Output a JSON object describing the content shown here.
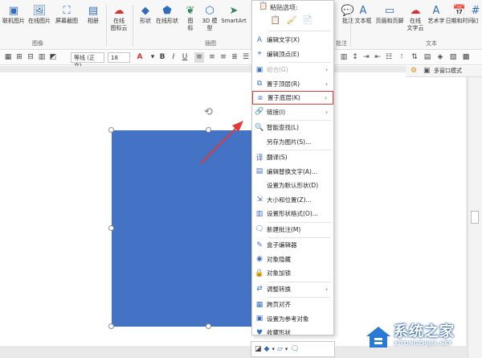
{
  "ribbon": {
    "buttons": [
      {
        "label": "联机图片",
        "icon": "online-picture-icon"
      },
      {
        "label": "在线图片",
        "icon": "online-image-icon"
      },
      {
        "label": "屏幕截图",
        "icon": "screenshot-icon"
      },
      {
        "label": "相册",
        "icon": "album-icon"
      },
      {
        "label": "在线\n图标云",
        "icon": "icon-cloud-icon"
      },
      {
        "label": "形状",
        "icon": "shape-icon"
      },
      {
        "label": "在线形状",
        "icon": "online-shape-icon"
      },
      {
        "label": "图\n标",
        "icon": "icons-icon"
      },
      {
        "label": "3D 模\n型",
        "icon": "3d-model-icon"
      },
      {
        "label": "SmartArt",
        "icon": "smartart-icon"
      },
      {
        "label": "批注",
        "icon": "comment-icon"
      },
      {
        "label": "文本框",
        "icon": "textbox-icon"
      },
      {
        "label": "页眉和页脚",
        "icon": "header-footer-icon"
      },
      {
        "label": "在线\n文字云",
        "icon": "word-cloud-icon"
      },
      {
        "label": "艺术字",
        "icon": "wordart-icon"
      },
      {
        "label": "日期和时间",
        "icon": "date-time-icon"
      },
      {
        "label": "幻",
        "icon": "slide-number-icon"
      }
    ],
    "groups": {
      "image": "图像",
      "illustration": "插图",
      "comment": "批注",
      "text": "文本"
    }
  },
  "format_bar": {
    "font": "等线 (正文)",
    "size": "18"
  },
  "side_panel": {
    "label": "多窗口模式"
  },
  "context_menu": {
    "paste_title": "粘贴选项:",
    "items": [
      {
        "label": "编辑文字(X)",
        "icon": "edit-text-icon",
        "arrow": false,
        "disabled": false
      },
      {
        "label": "编辑顶点(E)",
        "icon": "edit-points-icon",
        "arrow": false,
        "disabled": false
      },
      {
        "label": "组合(G)",
        "icon": "group-icon",
        "arrow": true,
        "disabled": true
      },
      {
        "label": "置于顶层(R)",
        "icon": "bring-to-front-icon",
        "arrow": true,
        "disabled": false
      },
      {
        "label": "置于底层(K)",
        "icon": "send-to-back-icon",
        "arrow": true,
        "disabled": false,
        "highlight": true
      },
      {
        "label": "链接(I)",
        "icon": "link-icon",
        "arrow": true,
        "disabled": false
      },
      {
        "label": "智能查找(L)",
        "icon": "smart-lookup-icon",
        "arrow": false,
        "disabled": false
      },
      {
        "label": "另存为图片(S)...",
        "icon": "save-as-picture-icon",
        "arrow": false,
        "disabled": false
      },
      {
        "label": "翻译(S)",
        "icon": "translate-icon",
        "arrow": false,
        "disabled": false
      },
      {
        "label": "编辑替换文字(A)...",
        "icon": "alt-text-icon",
        "arrow": false,
        "disabled": false
      },
      {
        "label": "设置为默认形状(D)",
        "icon": "default-shape-icon",
        "arrow": false,
        "disabled": false
      },
      {
        "label": "大小和位置(Z)...",
        "icon": "size-position-icon",
        "arrow": false,
        "disabled": false
      },
      {
        "label": "设置形状格式(O)...",
        "icon": "format-shape-icon",
        "arrow": false,
        "disabled": false
      },
      {
        "label": "新建批注(M)",
        "icon": "new-comment-icon",
        "arrow": false,
        "disabled": false
      },
      {
        "label": "盒子编辑器",
        "icon": "box-editor-icon",
        "arrow": false,
        "disabled": false
      },
      {
        "label": "对象隐藏",
        "icon": "hide-object-icon",
        "arrow": false,
        "disabled": false
      },
      {
        "label": "对象加锁",
        "icon": "lock-object-icon",
        "arrow": false,
        "disabled": false
      },
      {
        "label": "调整转换",
        "icon": "adjust-convert-icon",
        "arrow": true,
        "disabled": false
      },
      {
        "label": "跨页对齐",
        "icon": "cross-page-align-icon",
        "arrow": false,
        "disabled": false
      },
      {
        "label": "设置为参考对象",
        "icon": "reference-object-icon",
        "arrow": false,
        "disabled": false
      },
      {
        "label": "收藏形状",
        "icon": "favorite-shape-icon",
        "arrow": false,
        "disabled": false
      }
    ]
  },
  "watermark": {
    "title": "系统之家",
    "sub": "XITONGZHIJIA.NET"
  }
}
